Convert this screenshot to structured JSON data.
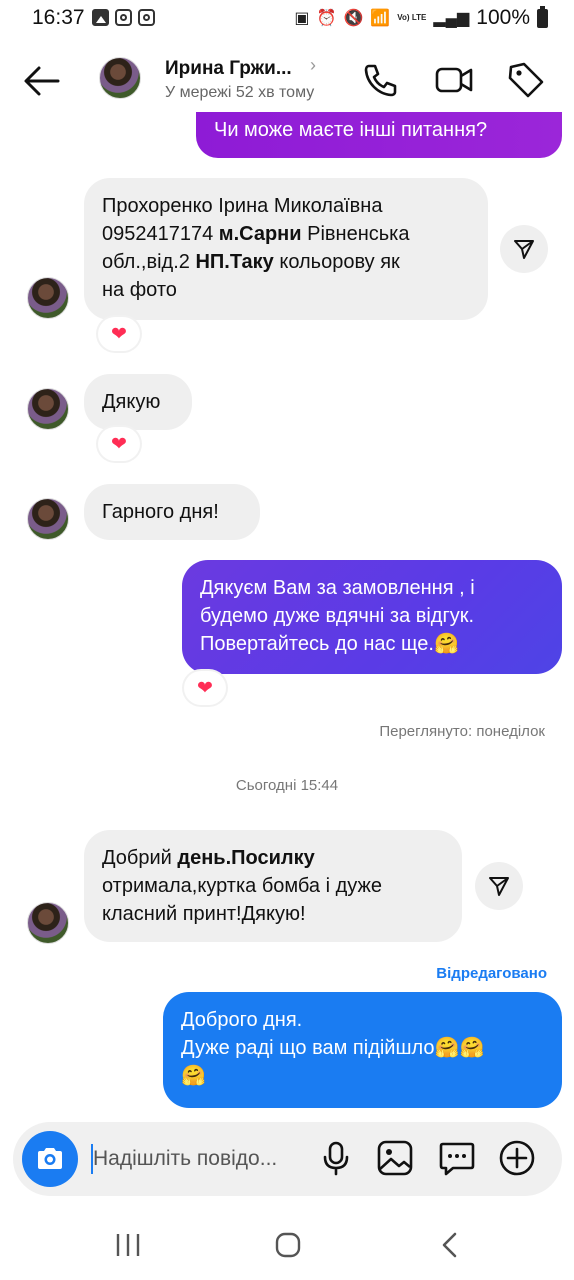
{
  "status_bar": {
    "time": "16:37",
    "battery": "100%",
    "lte_label": "Vo) LTE"
  },
  "header": {
    "name": "Ирина Гржи...",
    "status": "У мережі 52 хв тому",
    "icons": [
      "back-arrow-icon",
      "phone-icon",
      "video-camera-icon",
      "tag-icon"
    ]
  },
  "messages": [
    {
      "side": "out",
      "text": "Чи може маєте інші питання?"
    },
    {
      "side": "in",
      "lines": [
        "Прохоренко Ірина Миколаївна",
        "0952417174 ",
        "м.Сарни",
        " Рівненська",
        "обл.,від.2 ",
        "НП.Таку",
        " кольорову як",
        "на фото"
      ],
      "reaction": "❤"
    },
    {
      "side": "in",
      "text": "Дякую",
      "reaction": "❤"
    },
    {
      "side": "in",
      "text": "Гарного дня!"
    },
    {
      "side": "out",
      "lines": [
        "Дякуєм Вам  за замовлення , і",
        "будемо дуже вдячні за відгук.",
        "Повертайтесь до нас ще.🤗"
      ],
      "reaction": "❤"
    },
    {
      "side": "in",
      "lines": [
        "Добрий ",
        "день.Посилку",
        "отримала,куртка бомба і дуже",
        "класний принт!Дякую!"
      ]
    },
    {
      "side": "out",
      "lines": [
        "Доброго дня.",
        "Дуже раді що вам підійшло🤗🤗",
        "🤗"
      ]
    }
  ],
  "seen_label": "Переглянуто: понеділок",
  "date_separator": "Сьогодні 15:44",
  "edited_label": "Відредаговано",
  "composer": {
    "placeholder": "Надішліть повідо..."
  },
  "colors": {
    "outgoing_purple": "#9b26d9",
    "outgoing_violet": "#5a3be6",
    "outgoing_blue": "#1a7cf2",
    "incoming_gray": "#efefef",
    "reaction_red": "#ff2d55"
  }
}
